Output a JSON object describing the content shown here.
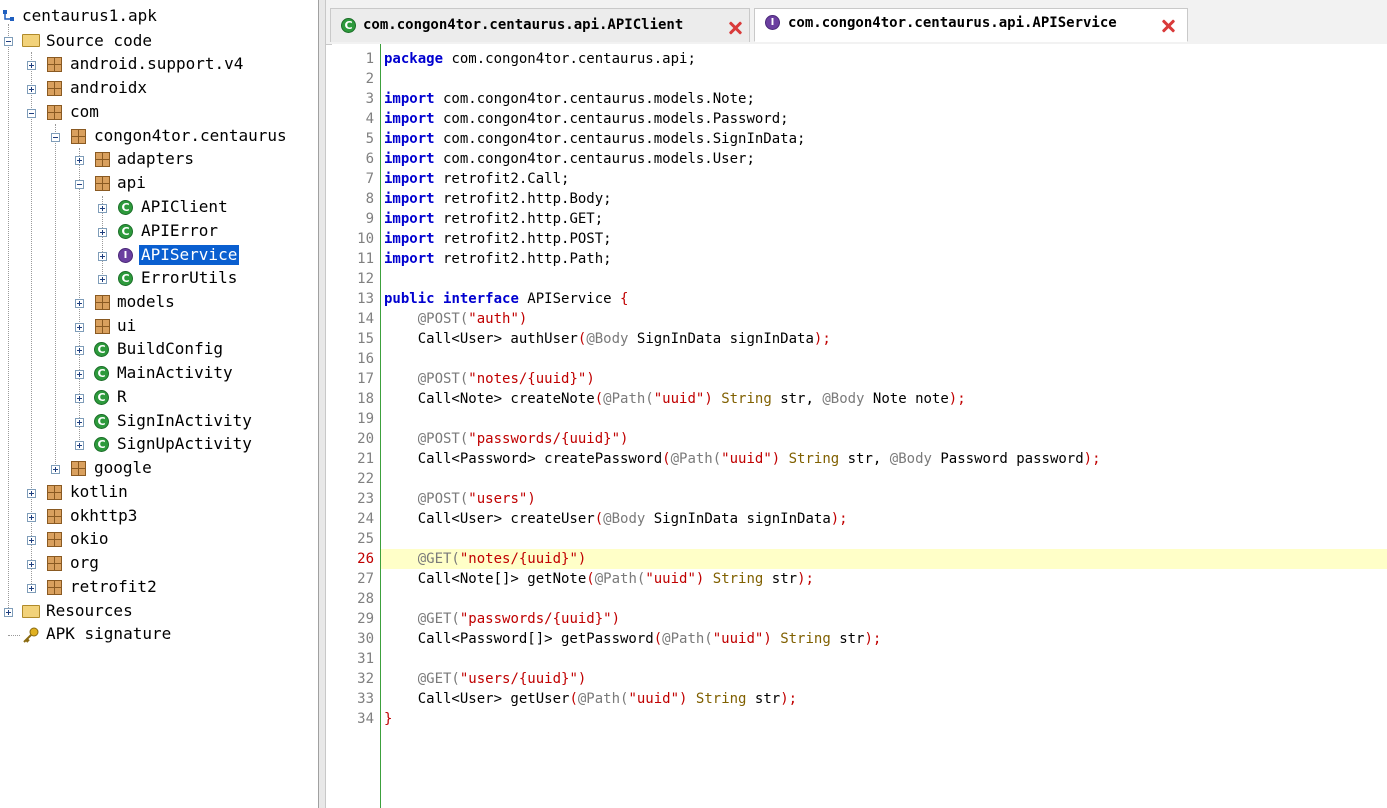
{
  "tree": {
    "root": "centaurus1.apk",
    "source_code": "Source code",
    "items": {
      "android_support": "android.support.v4",
      "androidx": "androidx",
      "com": "com",
      "congon4tor": "congon4tor.centaurus",
      "adapters": "adapters",
      "api": "api",
      "apiclient": "APIClient",
      "apierror": "APIError",
      "apiservice": "APIService",
      "errorutils": "ErrorUtils",
      "models": "models",
      "ui": "ui",
      "buildconfig": "BuildConfig",
      "mainactivity": "MainActivity",
      "r": "R",
      "signinactivity": "SignInActivity",
      "signupactivity": "SignUpActivity",
      "google": "google",
      "kotlin": "kotlin",
      "okhttp3": "okhttp3",
      "okio": "okio",
      "org": "org",
      "retrofit2": "retrofit2"
    },
    "resources": "Resources",
    "apk_signature": "APK signature",
    "icons": {
      "class": "C",
      "interface": "I"
    }
  },
  "tabs": [
    {
      "label": "com.congon4tor.centaurus.api.APIClient",
      "icon": "class-icon",
      "active": false
    },
    {
      "label": "com.congon4tor.centaurus.api.APIService",
      "icon": "interface-icon",
      "active": true
    }
  ],
  "editor": {
    "current_line": 26,
    "line_numbers": [
      "1",
      "2",
      "3",
      "4",
      "5",
      "6",
      "7",
      "8",
      "9",
      "10",
      "11",
      "12",
      "13",
      "14",
      "15",
      "16",
      "17",
      "18",
      "19",
      "20",
      "21",
      "22",
      "23",
      "24",
      "25",
      "26",
      "27",
      "28",
      "29",
      "30",
      "31",
      "32",
      "33",
      "34"
    ],
    "code": {
      "l1_kw": "package",
      "l1_rest": " com.congon4tor.centaurus.api;",
      "import_kw": "import",
      "l3": " com.congon4tor.centaurus.models.Note;",
      "l4": " com.congon4tor.centaurus.models.Password;",
      "l5": " com.congon4tor.centaurus.models.SignInData;",
      "l6": " com.congon4tor.centaurus.models.User;",
      "l7": " retrofit2.Call;",
      "l8": " retrofit2.http.Body;",
      "l9": " retrofit2.http.GET;",
      "l10": " retrofit2.http.POST;",
      "l11": " retrofit2.http.Path;",
      "l13_kw1": "public",
      "l13_kw2": "interface",
      "l13_name": " APIService ",
      "l13_brace": "{",
      "ann_post": "@POST(",
      "ann_get": "@GET(",
      "ann_body": "@Body",
      "ann_path": "@Path(",
      "paren_close": ")",
      "str_uuid": "\"uuid\"",
      "type_string": "String",
      "l14_str": "\"auth\"",
      "l15_a": "    Call<User> authUser",
      "l15_b": "(",
      "l15_c": " SignInData signInData",
      "l15_d": ");",
      "l17_str": "\"notes/{uuid}\"",
      "l18_a": "    Call<Note> createNote",
      "l18_b": "(",
      "l18_c": " str, ",
      "l18_d": " Note note",
      "l18_e": ");",
      "l20_str": "\"passwords/{uuid}\"",
      "l21_a": "    Call<Password> createPassword",
      "l21_b": "(",
      "l21_c": " str, ",
      "l21_d": " Password password",
      "l21_e": ");",
      "l23_str": "\"users\"",
      "l24_a": "    Call<User> createUser",
      "l24_b": "(",
      "l24_c": " SignInData signInData",
      "l24_d": ");",
      "l26_str": "\"notes/{uuid}\"",
      "l27_a": "    Call<Note[]> getNote",
      "l27_b": "(",
      "l27_c": " str",
      "l27_d": ");",
      "l29_str": "\"passwords/{uuid}\"",
      "l30_a": "    Call<Password[]> getPassword",
      "l30_b": "(",
      "l30_c": " str",
      "l30_d": ");",
      "l32_str": "\"users/{uuid}\"",
      "l33_a": "    Call<User> getUser",
      "l33_b": "(",
      "l33_c": " str",
      "l33_d": ");",
      "l34": "}"
    }
  },
  "colors": {
    "selection": "#0a5fd0",
    "current_line": "#ffffc8",
    "keyword": "#0000d0",
    "string": "#c00000",
    "annotation": "#7a7a7a"
  }
}
